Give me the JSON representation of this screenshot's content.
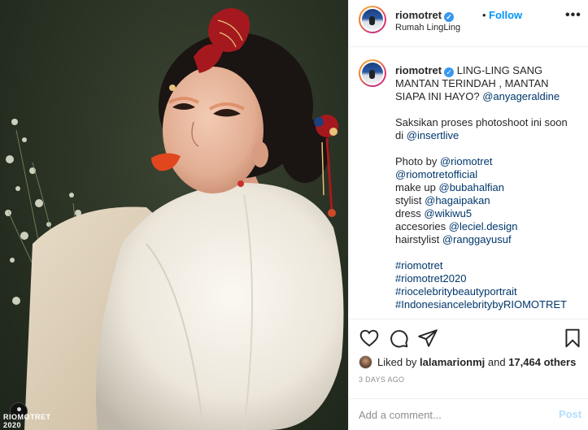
{
  "header": {
    "username": "riomotret",
    "separator": "•",
    "follow_label": "Follow",
    "location": "Rumah LingLing",
    "more_icon": "more-horizontal-icon"
  },
  "caption": {
    "username": "riomotret",
    "lines": [
      {
        "text": "LING-LING SANG MANTAN TERINDAH , MANTAN SIAPA INI HAYO?",
        "tag": "@anyageraldine"
      },
      {
        "text": "Saksikan proses photoshoot ini soon di",
        "tag": "@insertlive"
      },
      {
        "text": "Photo by",
        "tag": "@riomotret"
      },
      {
        "text": "",
        "tag": "@riomotretofficial"
      },
      {
        "text": "make up",
        "tag": "@bubahalfian"
      },
      {
        "text": "stylist",
        "tag": "@hagaipakan"
      },
      {
        "text": "dress",
        "tag": "@wikiwu5"
      },
      {
        "text": "accesories",
        "tag": "@leciel.design"
      },
      {
        "text": "hairstylist",
        "tag": "@ranggayusuf"
      }
    ],
    "hashtags": [
      "#riomotret",
      "#riomotret2020",
      "#riocelebritybeautyportrait",
      "#IndonesiancelebritybyRIOMOTRET"
    ]
  },
  "actions": {
    "like_icon": "heart-icon",
    "comment_icon": "comment-icon",
    "share_icon": "share-icon",
    "save_icon": "bookmark-icon"
  },
  "likes": {
    "prefix": "Liked by",
    "user": "lalamarionmj",
    "middle": "and",
    "count": "17,464 others"
  },
  "timestamp": "3 DAYS AGO",
  "comment": {
    "placeholder": "Add a comment...",
    "post_label": "Post"
  },
  "watermark": {
    "line1": "RIOMOTRET",
    "line2": "2020"
  },
  "colors": {
    "link": "#00376b",
    "follow": "#0095f6",
    "post_disabled": "#b2dffc",
    "verified": "#3897f0"
  }
}
